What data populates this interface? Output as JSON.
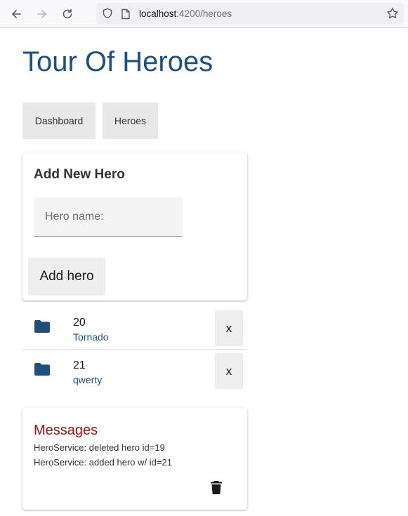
{
  "browser": {
    "url_host": "localhost",
    "url_path": ":4200/heroes"
  },
  "app": {
    "title": "Tour Of Heroes"
  },
  "nav": {
    "dashboard_label": "Dashboard",
    "heroes_label": "Heroes"
  },
  "add_hero": {
    "title": "Add New Hero",
    "input_placeholder": "Hero name:",
    "input_value": "",
    "button_label": "Add hero"
  },
  "heroes": [
    {
      "id": "20",
      "name": "Tornado",
      "delete_label": "x"
    },
    {
      "id": "21",
      "name": "qwerty",
      "delete_label": "x"
    }
  ],
  "messages": {
    "title": "Messages",
    "lines": [
      "HeroService: deleted hero id=19",
      "HeroService: added hero w/ id=21"
    ]
  },
  "icons": {
    "back": "arrow-left-icon",
    "forward": "arrow-right-icon",
    "reload": "reload-icon",
    "shield": "shield-icon",
    "page": "page-icon",
    "bookmark": "star-icon",
    "folder": "folder-icon",
    "trash": "trash-icon"
  },
  "colors": {
    "primary": "#1f4f7e",
    "messages_title": "#a50f0f",
    "button_bg": "#eeeeee"
  }
}
